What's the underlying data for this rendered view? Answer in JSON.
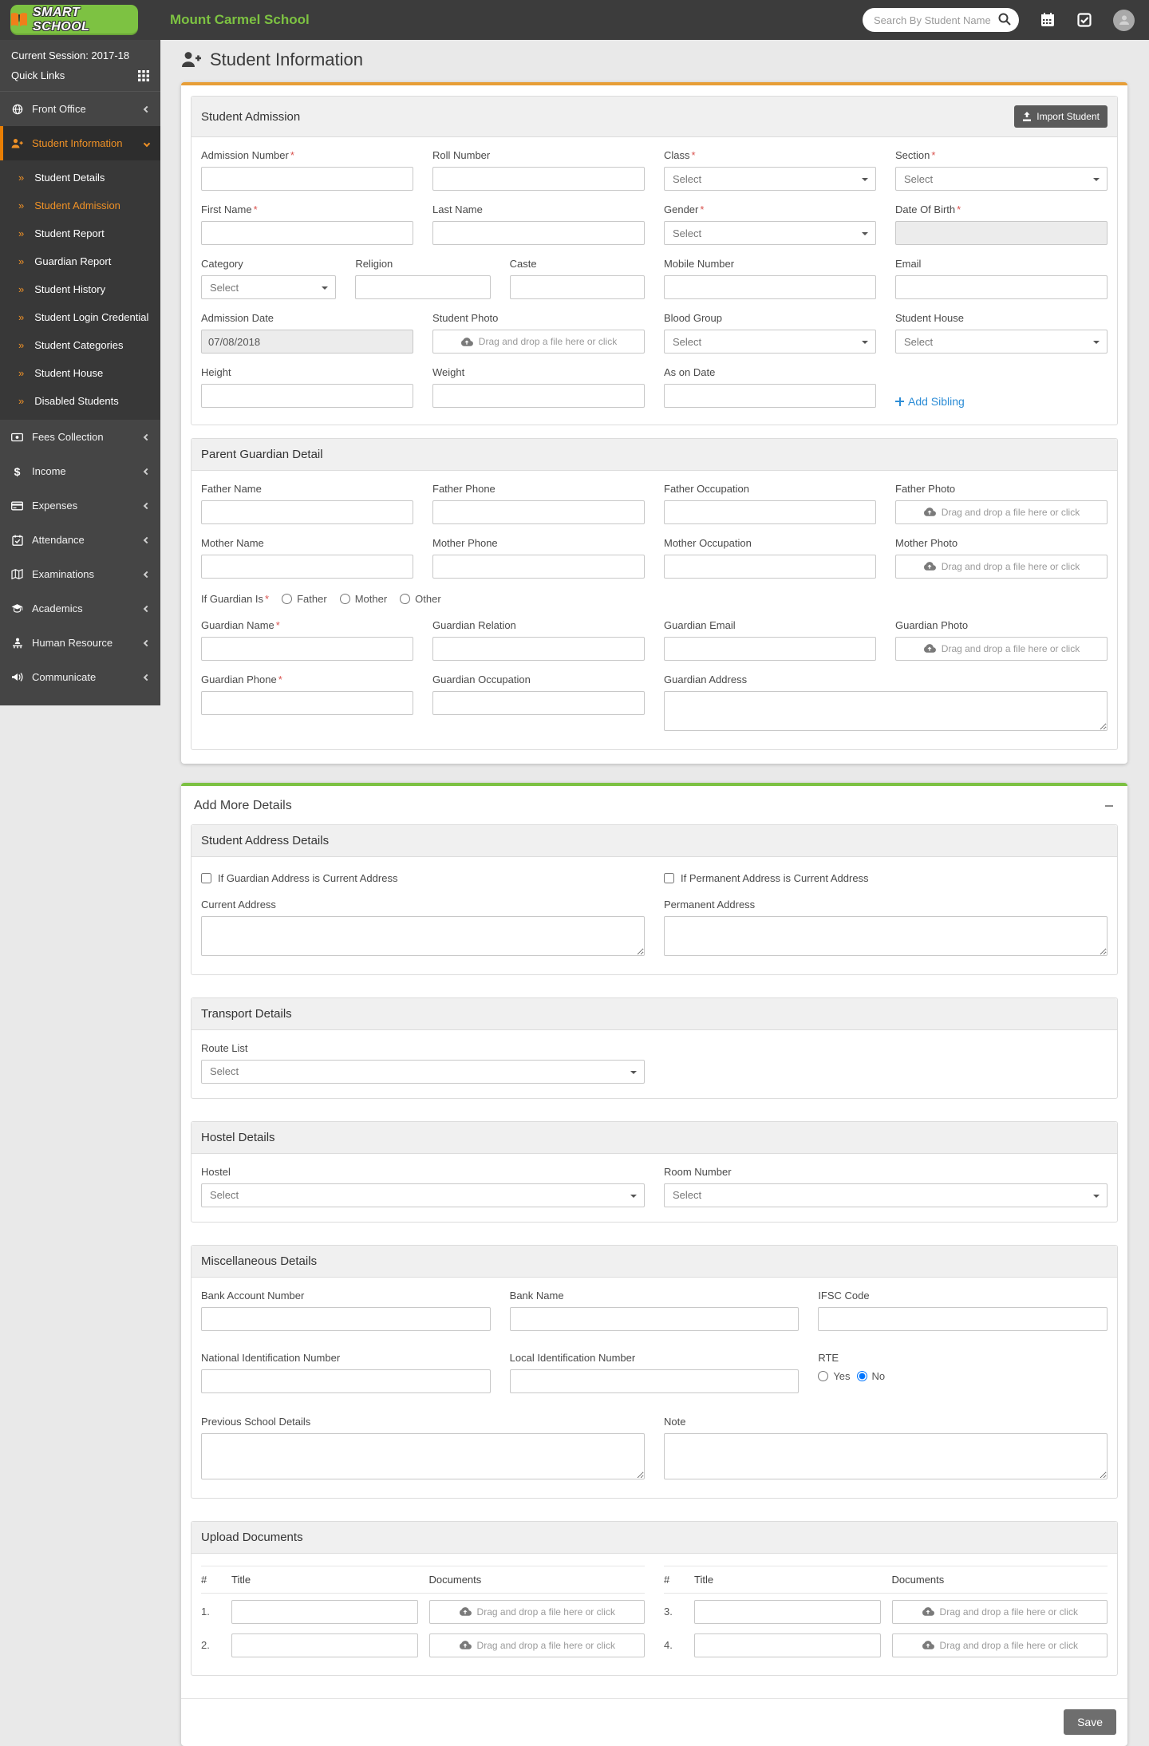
{
  "ui": {
    "select_placeholder": "Select",
    "file_drop_text": "Drag and drop a file here or click",
    "required_mark": "*",
    "submenu_chevrons": "»",
    "dollar": "$"
  },
  "header": {
    "logo_text": "SMART SCHOOL",
    "school_name": "Mount Carmel School",
    "search_placeholder": "Search By Student Name"
  },
  "sidebar": {
    "session": "Current Session: 2017-18",
    "quick_links": "Quick Links",
    "items": [
      {
        "label": "Front Office"
      },
      {
        "label": "Student Information"
      },
      {
        "label": "Fees Collection"
      },
      {
        "label": "Income"
      },
      {
        "label": "Expenses"
      },
      {
        "label": "Attendance"
      },
      {
        "label": "Examinations"
      },
      {
        "label": "Academics"
      },
      {
        "label": "Human Resource"
      },
      {
        "label": "Communicate"
      }
    ],
    "submenu": [
      "Student Details",
      "Student Admission",
      "Student Report",
      "Guardian Report",
      "Student History",
      "Student Login Credential",
      "Student Categories",
      "Student House",
      "Disabled Students"
    ]
  },
  "page": {
    "title": "Student Information"
  },
  "admission": {
    "title": "Student Admission",
    "import_button": "Import Student",
    "add_sibling": "Add Sibling",
    "admission_date_value": "07/08/2018",
    "labels": {
      "admission_number": "Admission Number",
      "roll_number": "Roll Number",
      "class": "Class",
      "section": "Section",
      "first_name": "First Name",
      "last_name": "Last Name",
      "gender": "Gender",
      "dob": "Date Of Birth",
      "category": "Category",
      "religion": "Religion",
      "caste": "Caste",
      "mobile": "Mobile Number",
      "email": "Email",
      "admission_date": "Admission Date",
      "student_photo": "Student Photo",
      "blood_group": "Blood Group",
      "student_house": "Student House",
      "height": "Height",
      "weight": "Weight",
      "as_on_date": "As on Date"
    }
  },
  "guardian": {
    "title": "Parent Guardian Detail",
    "labels": {
      "father_name": "Father Name",
      "father_phone": "Father Phone",
      "father_occupation": "Father Occupation",
      "father_photo": "Father Photo",
      "mother_name": "Mother Name",
      "mother_phone": "Mother Phone",
      "mother_occupation": "Mother Occupation",
      "mother_photo": "Mother Photo",
      "if_guardian_is": "If Guardian Is",
      "father": "Father",
      "mother": "Mother",
      "other": "Other",
      "guardian_name": "Guardian Name",
      "guardian_relation": "Guardian Relation",
      "guardian_email": "Guardian Email",
      "guardian_photo": "Guardian Photo",
      "guardian_phone": "Guardian Phone",
      "guardian_occupation": "Guardian Occupation",
      "guardian_address": "Guardian Address"
    }
  },
  "more": {
    "title": "Add More Details",
    "address": {
      "title": "Student Address Details",
      "guardian_checkbox": "If Guardian Address is Current Address",
      "permanent_checkbox": "If Permanent Address is Current Address",
      "current_label": "Current Address",
      "permanent_label": "Permanent Address"
    },
    "transport": {
      "title": "Transport Details",
      "route_label": "Route List"
    },
    "hostel": {
      "title": "Hostel Details",
      "hostel_label": "Hostel",
      "room_label": "Room Number"
    },
    "misc": {
      "title": "Miscellaneous Details",
      "bank_account": "Bank Account Number",
      "bank_name": "Bank Name",
      "ifsc": "IFSC Code",
      "national_id": "National Identification Number",
      "local_id": "Local Identification Number",
      "rte": "RTE",
      "yes": "Yes",
      "no": "No",
      "previous_school": "Previous School Details",
      "note": "Note"
    },
    "documents": {
      "title": "Upload Documents",
      "hash": "#",
      "title_col": "Title",
      "docs_col": "Documents",
      "rows": [
        "1.",
        "2.",
        "3.",
        "4."
      ]
    },
    "save": "Save"
  }
}
